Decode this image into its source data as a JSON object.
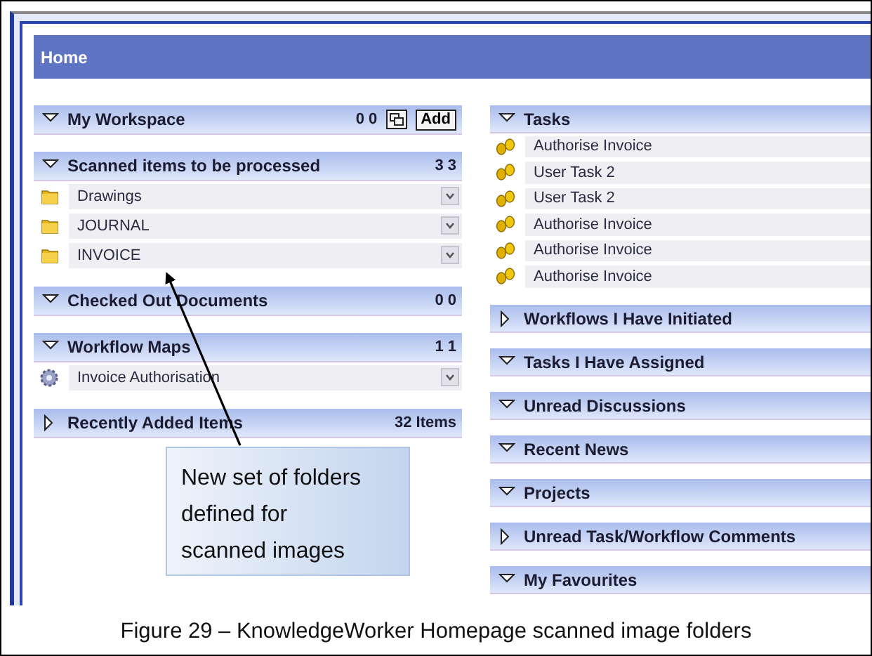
{
  "home": {
    "title": "Home"
  },
  "left_panels": [
    {
      "title": "My Workspace",
      "expanded": true,
      "count": "0 0",
      "add_button": "Add"
    },
    {
      "title": "Scanned items to be processed",
      "expanded": true,
      "count": "3 3",
      "items": [
        {
          "label": "Drawings",
          "kind": "folder"
        },
        {
          "label": "JOURNAL",
          "kind": "folder"
        },
        {
          "label": "INVOICE",
          "kind": "folder"
        }
      ]
    },
    {
      "title": "Checked Out Documents",
      "expanded": true,
      "count": "0 0"
    },
    {
      "title": "Workflow Maps",
      "expanded": true,
      "count": "1 1",
      "items": [
        {
          "label": "Invoice Authorisation",
          "kind": "workflow"
        }
      ]
    },
    {
      "title": "Recently Added Items",
      "expanded": false,
      "count": "32 Items"
    }
  ],
  "right_panels": [
    {
      "title": "Tasks",
      "expanded": true,
      "items": [
        {
          "label": "Authorise Invoice",
          "kind": "task"
        },
        {
          "label": "User Task 2",
          "kind": "task"
        },
        {
          "label": "User Task 2",
          "kind": "task"
        },
        {
          "label": "Authorise Invoice",
          "kind": "task"
        },
        {
          "label": "Authorise Invoice",
          "kind": "task"
        },
        {
          "label": "Authorise Invoice",
          "kind": "task"
        }
      ]
    },
    {
      "title": "Workflows I Have Initiated",
      "expanded": false
    },
    {
      "title": "Tasks I Have Assigned",
      "expanded": true
    },
    {
      "title": "Unread Discussions",
      "expanded": true
    },
    {
      "title": "Recent News",
      "expanded": true
    },
    {
      "title": "Projects",
      "expanded": true
    },
    {
      "title": "Unread Task/Workflow Comments",
      "expanded": false
    },
    {
      "title": "My Favourites",
      "expanded": true
    }
  ],
  "callout": {
    "text": "New set of folders\ndefined for\nscanned images"
  },
  "caption": "Figure 29 – KnowledgeWorker Homepage scanned image folders"
}
